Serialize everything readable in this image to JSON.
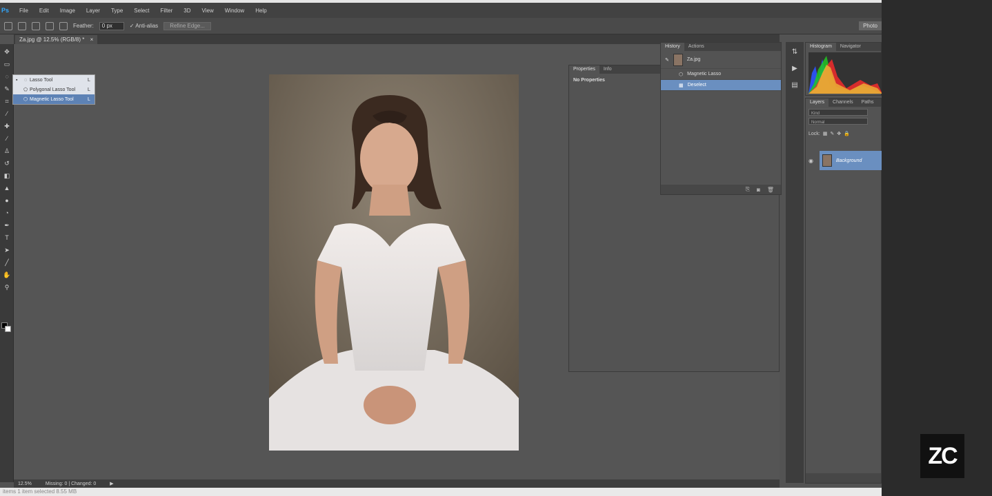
{
  "menu": {
    "app_badge": "Ps",
    "items": [
      "File",
      "Edit",
      "Image",
      "Layer",
      "Type",
      "Select",
      "Filter",
      "3D",
      "View",
      "Window",
      "Help"
    ]
  },
  "options_bar": {
    "feather_label": "Feather:",
    "feather_value": "0 px",
    "anti_alias_label": "Anti-alias",
    "refine_edge_label": "Refine Edge...",
    "workspace_label": "Photo"
  },
  "document": {
    "tab_title": "Za.jpg @ 12.5% (RGB/8) *",
    "close_glyph": "×"
  },
  "tool_flyout": {
    "items": [
      {
        "label": "Lasso Tool",
        "key": "L",
        "active": false
      },
      {
        "label": "Polygonal Lasso Tool",
        "key": "L",
        "active": false
      },
      {
        "label": "Magnetic Lasso Tool",
        "key": "L",
        "active": true
      }
    ]
  },
  "properties_panel": {
    "tabs": [
      "Properties",
      "Info"
    ],
    "message": "No Properties"
  },
  "history_panel": {
    "tabs": [
      "History",
      "Actions"
    ],
    "snapshot_label": "Za.jpg",
    "states": [
      {
        "label": "Magnetic Lasso",
        "selected": false
      },
      {
        "label": "Deselect",
        "selected": true
      }
    ]
  },
  "histogram_panel": {
    "tabs": [
      "Histogram",
      "Navigator"
    ]
  },
  "layers_panel": {
    "tabs": [
      "Layers",
      "Channels",
      "Paths"
    ],
    "kind_filter": "Kind",
    "blend_mode": "Normal",
    "lock_label": "Lock:",
    "layer_name": "Background"
  },
  "status_bar": {
    "zoom": "12.5%",
    "info": "Missing: 0 | Changed: 0"
  },
  "bottom_strip": {
    "text": "items     1 item selected  8.55 MB"
  },
  "watermark": {
    "logo_text": "ZC"
  }
}
